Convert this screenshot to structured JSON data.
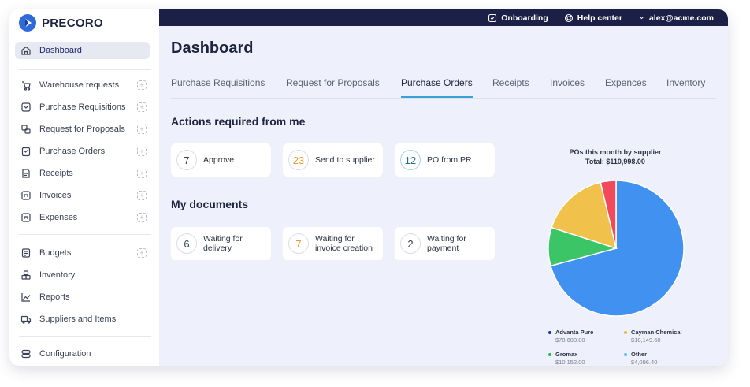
{
  "brand": {
    "name": "PRECORO"
  },
  "sidebar": {
    "items": [
      {
        "label": "Dashboard",
        "icon": "home-icon",
        "active": true
      },
      {
        "label": "Warehouse requests",
        "icon": "warehouse-request-icon",
        "plus": true
      },
      {
        "label": "Purchase Requisitions",
        "icon": "requisition-icon",
        "plus": true
      },
      {
        "label": "Request for Proposals",
        "icon": "proposal-icon",
        "plus": true
      },
      {
        "label": "Purchase Orders",
        "icon": "purchase-order-icon",
        "plus": true
      },
      {
        "label": "Receipts",
        "icon": "receipt-icon",
        "plus": true
      },
      {
        "label": "Invoices",
        "icon": "invoice-icon",
        "plus": true
      },
      {
        "label": "Expenses",
        "icon": "expense-icon",
        "plus": true
      },
      {
        "label": "Budgets",
        "icon": "budget-icon",
        "plus": true
      },
      {
        "label": "Inventory",
        "icon": "inventory-icon"
      },
      {
        "label": "Reports",
        "icon": "reports-icon"
      },
      {
        "label": "Suppliers and Items",
        "icon": "truck-icon"
      },
      {
        "label": "Configuration",
        "icon": "configuration-icon"
      }
    ],
    "plus_symbol": "+"
  },
  "topbar": {
    "onboarding": "Onboarding",
    "help": "Help center",
    "user": "alex@acme.com"
  },
  "main": {
    "title": "Dashboard",
    "tabs": [
      "Purchase Requisitions",
      "Request for Proposals",
      "Purchase Orders",
      "Receipts",
      "Invoices",
      "Expences",
      "Inventory"
    ],
    "active_tab": "Purchase Orders",
    "actions": {
      "title": "Actions required from me",
      "cards": [
        {
          "count": "7",
          "label": "Approve",
          "color": "#3a4157"
        },
        {
          "count": "23",
          "label": "Send to supplier",
          "color": "#e0a13a"
        },
        {
          "count": "12",
          "label": "PO from PR",
          "color": "#2a6b8c"
        }
      ]
    },
    "documents": {
      "title": "My documents",
      "cards": [
        {
          "count": "6",
          "label": "Waiting for delivery",
          "color": "#3a4157"
        },
        {
          "count": "7",
          "label": "Waiting for invoice creation",
          "color": "#e0a13a"
        },
        {
          "count": "2",
          "label": "Waiting for payment",
          "color": "#3a4157"
        }
      ]
    }
  },
  "chart_data": {
    "type": "pie",
    "title": "POs this month by supplier",
    "subtitle": "Total: $110,998.00",
    "slices": [
      {
        "name": "Advanta Pure",
        "value": 78600.0,
        "display": "$78,600.00",
        "color": "#4191f0",
        "legend_color": "#1e2fbf"
      },
      {
        "name": "Gromax",
        "value": 10152.0,
        "display": "$10,152.00",
        "color": "#3cc566",
        "legend_color": "#2bb35a"
      },
      {
        "name": "Cayman Chemical",
        "value": 18149.6,
        "display": "$18,149.60",
        "color": "#f0c14b",
        "legend_color": "#f0b43a"
      },
      {
        "name": "Other",
        "value": 4096.4,
        "display": "$4,096.40",
        "color": "#f04a5c",
        "legend_color": "#5bc0f0"
      }
    ],
    "legend_position": "bottom"
  }
}
